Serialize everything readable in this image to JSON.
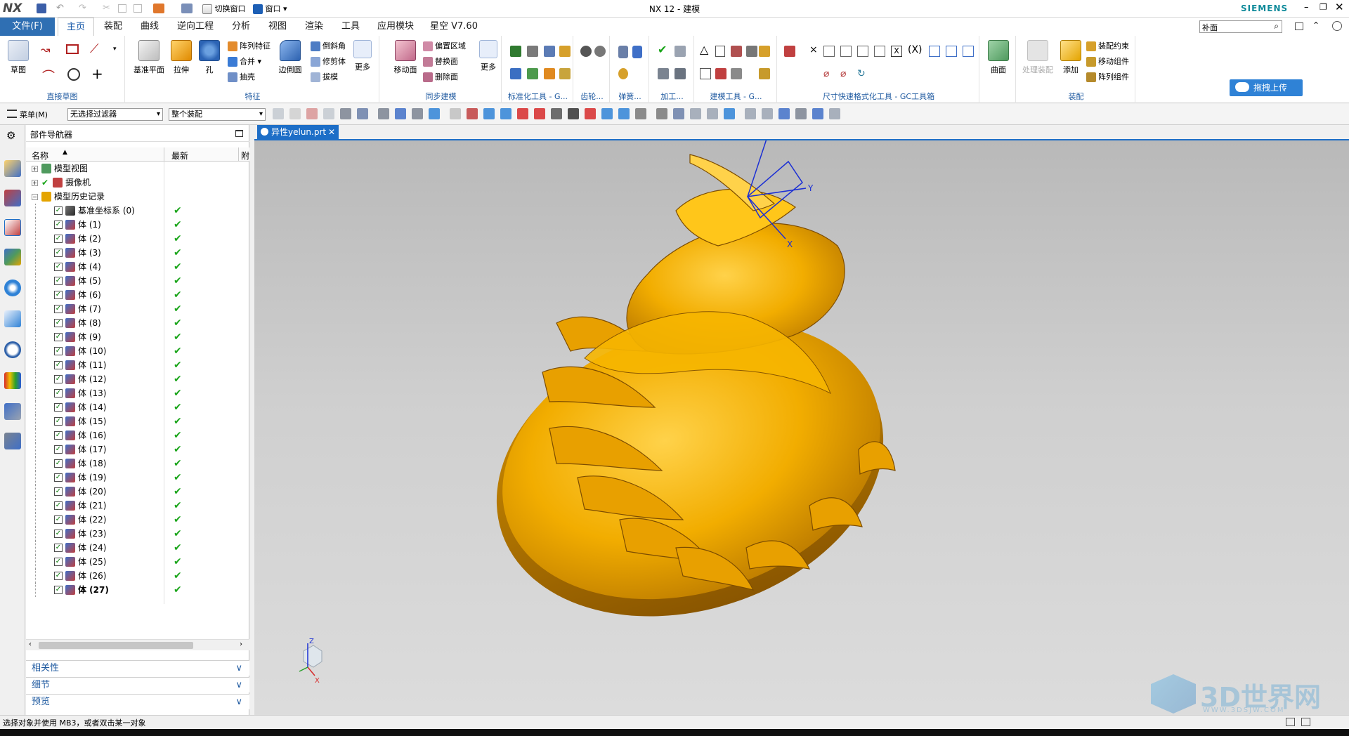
{
  "app": {
    "logo": "NX",
    "window_title": "NX 12 - 建模",
    "brand": "SIEMENS",
    "switch_window": "切换窗口",
    "window_menu": "窗口"
  },
  "menubar": {
    "file": "文件(F)",
    "tabs": [
      "主页",
      "装配",
      "曲线",
      "逆向工程",
      "分析",
      "视图",
      "渲染",
      "工具",
      "应用模块",
      "星空 V7.60"
    ],
    "search_value": "补面"
  },
  "ribbon": {
    "groups": {
      "sketch": {
        "label": "直接草图",
        "big": "草图"
      },
      "feature": {
        "label": "特征",
        "big": [
          "基准平面",
          "拉伸",
          "孔"
        ],
        "small": [
          "阵列特征",
          "合并",
          "抽壳",
          "倒斜角",
          "修剪体",
          "拔模"
        ],
        "more": "更多",
        "edge": "边倒圆"
      },
      "sync": {
        "label": "同步建模",
        "big": "移动面",
        "small": [
          "偏置区域",
          "替换面",
          "删除面"
        ],
        "more": "更多"
      },
      "std": {
        "label": "标准化工具 - G..."
      },
      "gear": {
        "label": "齿轮..."
      },
      "spring": {
        "label": "弹簧..."
      },
      "machining": {
        "label": "加工..."
      },
      "modeling": {
        "label": "建模工具 - G..."
      },
      "dim": {
        "label": "尺寸快速格式化工具 - GC工具箱"
      },
      "surface": {
        "label": "曲面"
      },
      "assembly": {
        "label": "装配",
        "big": [
          "处理装配",
          "添加"
        ],
        "small": [
          "装配约束",
          "移动组件",
          "阵列组件"
        ]
      },
      "upload": {
        "label": "拖拽上传"
      }
    }
  },
  "toolbar2": {
    "menu": "菜单(M)",
    "filter": "无选择过滤器",
    "scope": "整个装配"
  },
  "navigator": {
    "title": "部件导航器",
    "col_name": "名称",
    "col_latest": "最新",
    "col_extra": "附",
    "nodes": [
      {
        "label": "模型视图",
        "level": 0
      },
      {
        "label": "摄像机",
        "level": 0
      },
      {
        "label": "模型历史记录",
        "level": 0
      }
    ],
    "history": [
      "基准坐标系 (0)",
      "体 (1)",
      "体 (2)",
      "体 (3)",
      "体 (4)",
      "体 (5)",
      "体 (6)",
      "体 (7)",
      "体 (8)",
      "体 (9)",
      "体 (10)",
      "体 (11)",
      "体 (12)",
      "体 (13)",
      "体 (14)",
      "体 (15)",
      "体 (16)",
      "体 (17)",
      "体 (18)",
      "体 (19)",
      "体 (20)",
      "体 (21)",
      "体 (22)",
      "体 (23)",
      "体 (24)",
      "体 (25)",
      "体 (26)",
      "体 (27)"
    ],
    "accordions": [
      "相关性",
      "细节",
      "预览"
    ]
  },
  "document": {
    "tab": "异性yelun.prt"
  },
  "viewport": {
    "axes": {
      "x": "X",
      "y": "Y",
      "z": "Z"
    },
    "watermark": "3D世界网",
    "watermark_url": "WWW.3DSJW.COM"
  },
  "status": {
    "text": "选择对象并使用 MB3，或者双击某一对象"
  },
  "colors": {
    "part": "#f5b400",
    "accent": "#1d6ec7",
    "file_menu": "#2f6fb3"
  }
}
